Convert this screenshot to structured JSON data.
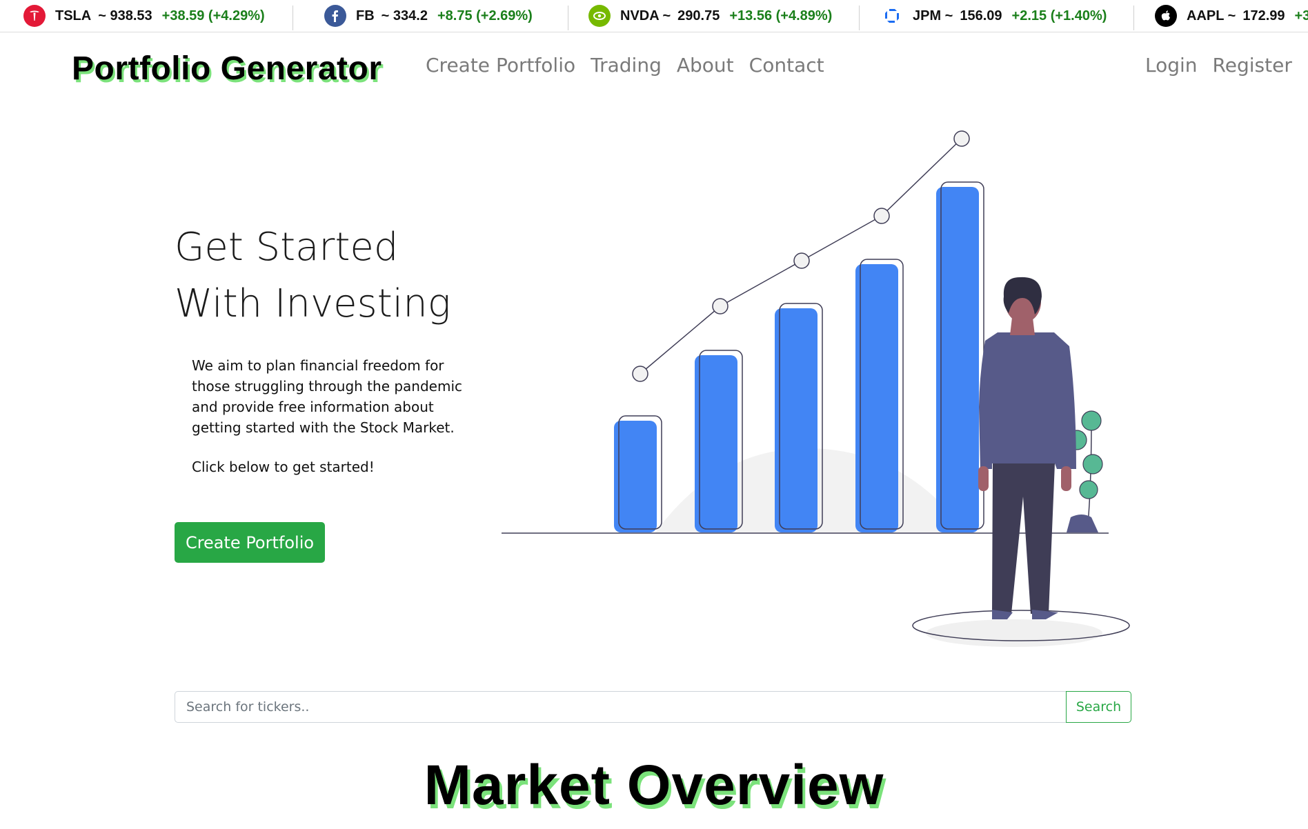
{
  "ticker": [
    {
      "symbol": "TSLA",
      "price": "~ 938.53",
      "change": "+38.59 (+4.29%)",
      "icon": "tesla-logo-icon",
      "color": "#e31937"
    },
    {
      "symbol": "FB",
      "price": "~ 334.2",
      "change": "+8.75 (+2.69%)",
      "icon": "facebook-logo-icon",
      "color": "#3b5998"
    },
    {
      "symbol": "NVDA ~",
      "price": "290.75",
      "change": "+13.56 (+4.89%)",
      "icon": "nvidia-logo-icon",
      "color": "#76b900"
    },
    {
      "symbol": "JPM ~",
      "price": "156.09",
      "change": "+2.15 (+1.40%)",
      "icon": "jpm-logo-icon",
      "color": "#1b6cf2"
    },
    {
      "symbol": "AAPL ~",
      "price": "172.99",
      "change": "+3",
      "icon": "apple-logo-icon",
      "color": "#000000"
    }
  ],
  "navbar": {
    "brand": "Portfolio Generator",
    "links": [
      "Create Portfolio",
      "Trading",
      "About",
      "Contact"
    ],
    "auth": [
      "Login",
      "Register"
    ]
  },
  "hero": {
    "title": "Get Started\nWith Investing",
    "description": "We aim to plan financial freedom for those struggling through the pandemic and provide free information about getting started with the Stock Market.",
    "cta_text": "Click below to get started!",
    "button": "Create Portfolio"
  },
  "search": {
    "placeholder": "Search for tickers..",
    "button": "Search"
  },
  "market_overview": {
    "title": "Market Overview"
  },
  "colors": {
    "accent": "#28a745",
    "bar": "#4285f4",
    "suit": "#575a89",
    "gain": "#1a7f1a"
  }
}
